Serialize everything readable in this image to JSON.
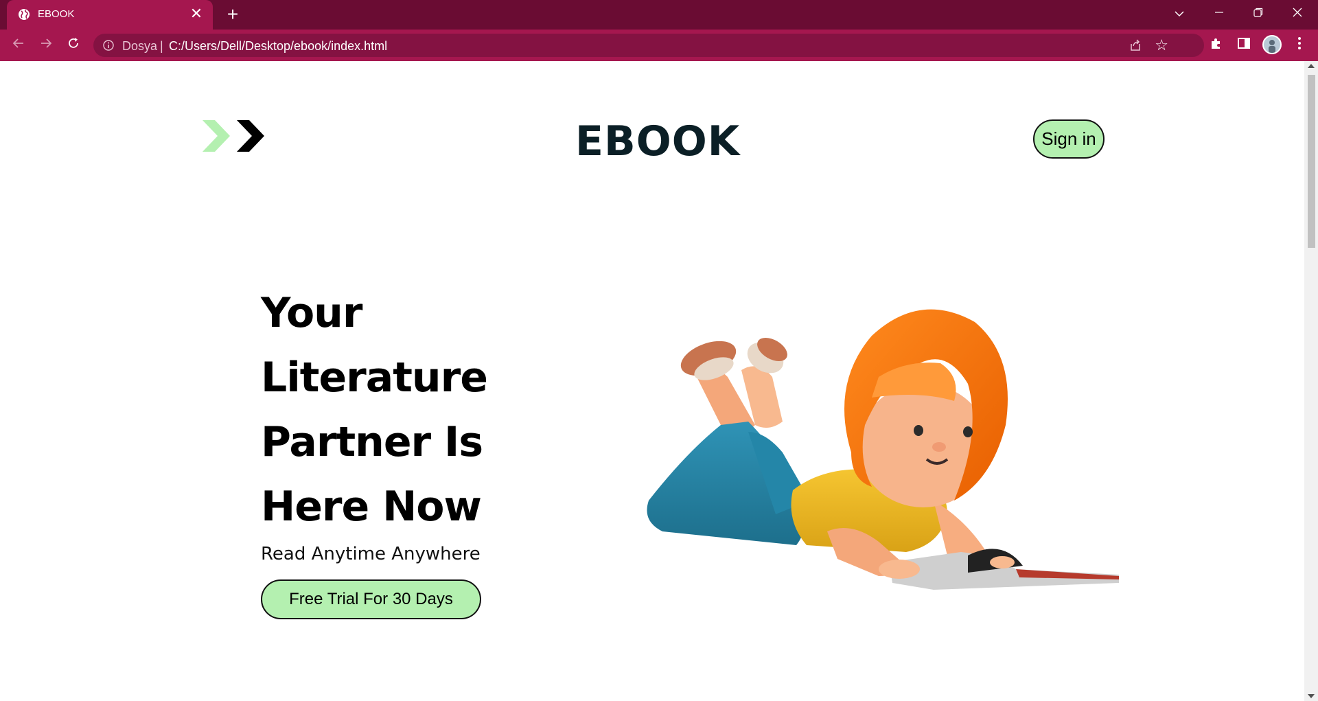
{
  "browser": {
    "tab_title": "EBOOK",
    "tab_close": "✕",
    "new_tab": "+",
    "site_label": "Dosya",
    "url_separator": "|",
    "url": "C:/Users/Dell/Desktop/ebook/index.html",
    "icons": [
      "globe-icon",
      "close-icon",
      "plus-icon",
      "chevron-down-icon",
      "minimize-icon",
      "restore-icon",
      "close-window-icon",
      "back-arrow-icon",
      "forward-arrow-icon",
      "reload-icon",
      "info-icon",
      "share-icon",
      "star-icon",
      "puzzle-extensions-icon",
      "side-panel-icon",
      "profile-avatar",
      "kebab-menu-icon"
    ],
    "theme_colors": {
      "tabbar": "#6a0c33",
      "toolbar": "#a5174f",
      "omnibox": "#841242"
    }
  },
  "page": {
    "brand": "EBOOK",
    "signin_label": "Sign in",
    "headline_lines": [
      "Your",
      "Literature",
      "Partner Is",
      "Here Now"
    ],
    "subline": "Read Anytime Anywhere",
    "cta_label": "Free Trial For 30 Days",
    "accent_color": "#b4f0b0",
    "illustration": "girl-reading-book-illustration"
  }
}
